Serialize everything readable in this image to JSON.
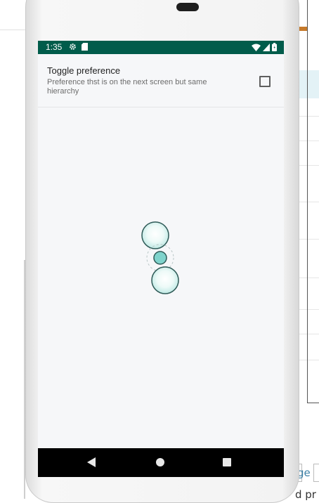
{
  "status_bar": {
    "time": "1:35",
    "left_icons": [
      "gear-icon",
      "sd-card-icon"
    ],
    "right_icons": [
      "wifi-icon",
      "signal-icon",
      "battery-icon"
    ],
    "background": "#015c4b"
  },
  "preference": {
    "title": "Toggle preference",
    "summary": "Preference thst is on the next screen but same hierarchy",
    "checked": false
  },
  "navigation_bar": {
    "buttons": [
      "back-icon",
      "home-icon",
      "recents-icon"
    ]
  },
  "background_ide": {
    "bottom_text_1": "ge",
    "bottom_text_2": "d pr"
  },
  "colors": {
    "accent": "#015c4b",
    "touch_indicator": "#7fd3cc"
  }
}
